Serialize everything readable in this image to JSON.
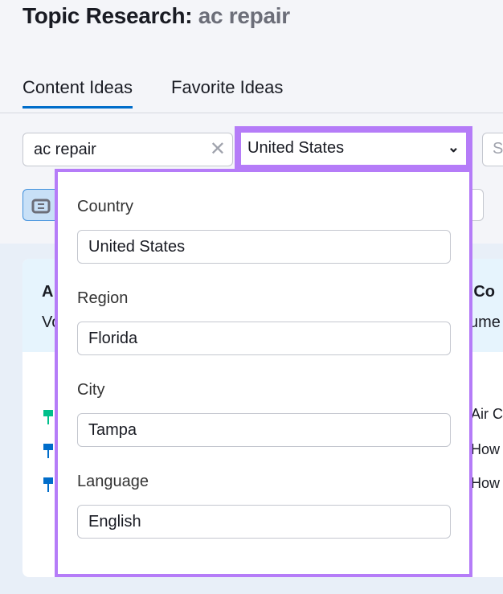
{
  "header": {
    "title": "Topic Research:",
    "keyword": "ac repair"
  },
  "tabs": [
    {
      "label": "Content Ideas",
      "active": true
    },
    {
      "label": "Favorite Ideas",
      "active": false
    }
  ],
  "search": {
    "value": "ac repair"
  },
  "location_select": {
    "value": "United States"
  },
  "extra_field": {
    "placeholder": "S"
  },
  "background": {
    "card_title_a": "A",
    "card_sub_a": "Vo",
    "card_title_b": "r Co",
    "card_sub_b": "ume",
    "rows": [
      "Air C",
      "How",
      "How"
    ]
  },
  "popup": {
    "fields": [
      {
        "label": "Country",
        "value": "United States"
      },
      {
        "label": "Region",
        "value": "Florida"
      },
      {
        "label": "City",
        "value": "Tampa"
      },
      {
        "label": "Language",
        "value": "English"
      }
    ]
  },
  "colors": {
    "accent": "#006dca",
    "highlight": "#b57cf8",
    "pin_green": "#00c08b",
    "pin_blue": "#006dca"
  }
}
